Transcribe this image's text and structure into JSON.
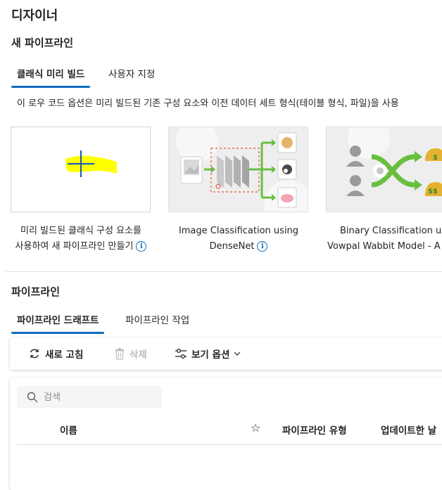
{
  "header": {
    "title": "디자이너"
  },
  "new_pipeline": {
    "title": "새 파이프라인",
    "tabs": [
      {
        "label": "클래식 미리 빌드",
        "active": true
      },
      {
        "label": "사용자 지정",
        "active": false
      }
    ],
    "description": "이 로우 코드 옵션은 미리 빌드된 기존 구성 요소와 이전 데이터 세트 형식(테이블 형식, 파일)을 사용",
    "cards": [
      {
        "line1": "미리 빌드된 클래식 구성 요소를",
        "line2": "사용하여 새 파이프라인 만들기",
        "icon": "plus-icon"
      },
      {
        "line1": "Image Classification using",
        "line2": "DenseNet",
        "icon": "image-classification-thumbnail"
      },
      {
        "line1": "Binary Classification usin",
        "line2": "Vowpal Wabbit Model - A",
        "icon": "binary-classification-thumbnail"
      }
    ],
    "info_glyph": "i"
  },
  "pipelines": {
    "title": "파이프라인",
    "tabs": [
      {
        "label": "파이프라인 드래프트",
        "active": true
      },
      {
        "label": "파이프라인 작업",
        "active": false
      }
    ],
    "toolbar": {
      "refresh": "새로 고침",
      "delete": "삭제",
      "view_options": "보기 옵션"
    },
    "search_placeholder": "검색",
    "columns": {
      "name": "이름",
      "star": "☆",
      "type": "파이프라인 유형",
      "updated": "업데이트한 날"
    }
  },
  "colors": {
    "accent": "#0f6cbd",
    "highlight": "#ffff00",
    "green": "#6abf40"
  }
}
